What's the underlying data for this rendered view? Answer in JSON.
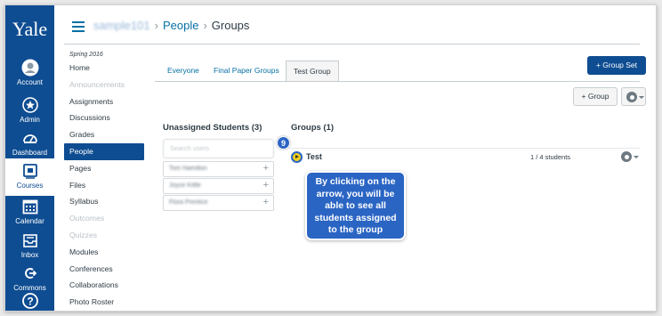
{
  "global_nav": {
    "logo": "Yale",
    "items": [
      {
        "label": "Account",
        "icon": "account-icon"
      },
      {
        "label": "Admin",
        "icon": "admin-icon"
      },
      {
        "label": "Dashboard",
        "icon": "dashboard-icon"
      },
      {
        "label": "Courses",
        "icon": "courses-icon",
        "active": true
      },
      {
        "label": "Calendar",
        "icon": "calendar-icon"
      },
      {
        "label": "Inbox",
        "icon": "inbox-icon"
      },
      {
        "label": "Commons",
        "icon": "commons-icon"
      },
      {
        "label": "",
        "icon": "help-icon"
      }
    ]
  },
  "header": {
    "course": "sample101",
    "crumb_people": "People",
    "crumb_groups": "Groups",
    "separator": "›"
  },
  "course_nav": {
    "term": "Spring 2016",
    "items": [
      {
        "label": "Home",
        "state": "normal"
      },
      {
        "label": "Announcements",
        "state": "dim"
      },
      {
        "label": "Assignments",
        "state": "normal"
      },
      {
        "label": "Discussions",
        "state": "normal"
      },
      {
        "label": "Grades",
        "state": "normal"
      },
      {
        "label": "People",
        "state": "active"
      },
      {
        "label": "Pages",
        "state": "normal"
      },
      {
        "label": "Files",
        "state": "normal"
      },
      {
        "label": "Syllabus",
        "state": "normal"
      },
      {
        "label": "Outcomes",
        "state": "dim"
      },
      {
        "label": "Quizzes",
        "state": "dim"
      },
      {
        "label": "Modules",
        "state": "normal"
      },
      {
        "label": "Conferences",
        "state": "normal"
      },
      {
        "label": "Collaborations",
        "state": "normal"
      },
      {
        "label": "Photo Roster",
        "state": "normal"
      }
    ]
  },
  "tabs": [
    "Everyone",
    "Final Paper Groups",
    "Test Group"
  ],
  "buttons": {
    "add_group_set": "+ Group Set",
    "add_group": "+ Group"
  },
  "unassigned": {
    "title": "Unassigned Students (3)",
    "search_placeholder": "Search users",
    "students": [
      "Tom Hamilton",
      "Joyce Kittle",
      "Flora Prentice"
    ],
    "add_symbol": "+"
  },
  "groups": {
    "title": "Groups (1)",
    "items": [
      {
        "name": "Test",
        "count": "1 / 4 students"
      }
    ]
  },
  "annotation": {
    "step": "9",
    "callout": "By clicking on the arrow, you will be able to see all students assigned to the group"
  },
  "colors": {
    "nav_blue": "#0f4d92",
    "link_blue": "#0770a3",
    "callout_blue": "#2b65c4",
    "arrow_yellow": "#f6d01b"
  }
}
